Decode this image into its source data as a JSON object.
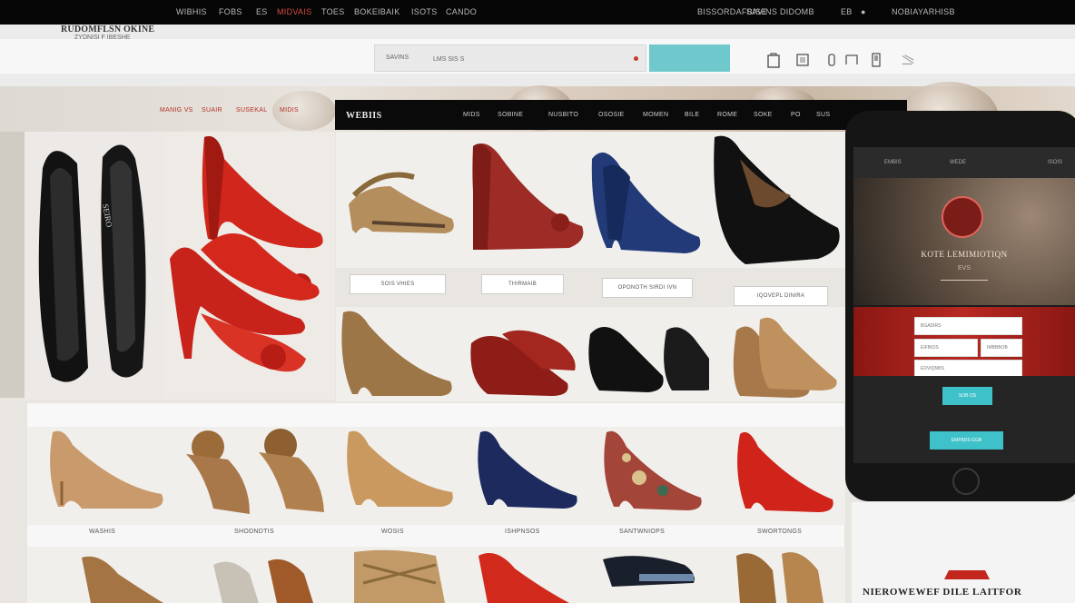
{
  "topbar": {
    "left_links": [
      "WIBHIS",
      "FOBS",
      "ES",
      "MIDVAIS",
      "TOES",
      "BOKE",
      "IBAIK",
      "ISOTS",
      "CANDO"
    ],
    "right_links": [
      "BISSORDAFBISE",
      "SAVINS DIDOMB",
      "EB",
      "●",
      "NOBIAYARHISB"
    ]
  },
  "header": {
    "logo": "RUDOMFLSN OKINE",
    "logo_sub": "ZYDNISI F IBESHE",
    "search_label": "SAVINS",
    "search_value": "LMS SIS S",
    "icons": [
      "bag-icon",
      "cart-icon",
      "user-icon",
      "star-icon",
      "lock-icon",
      "menu-icon"
    ]
  },
  "promo_links": [
    "MANIG VS",
    "SUAIR",
    "SUSEKAL",
    "MIDIS"
  ],
  "catnav": {
    "brand": "WEBIIS",
    "items": [
      "MIDS",
      "SOBINE",
      "NUSBITO",
      "OSOSIE",
      "MOMEN",
      "BILE",
      "ROME",
      "SOKE",
      "PO",
      "SUS"
    ]
  },
  "labels": {
    "row1": [
      "SOIS VHIES",
      "THIRMAIB",
      "OPONOTH SIRDI IVN",
      "IQOVEPL DINIRA"
    ],
    "row3": [
      "WASHIS",
      "SHODNDTIS",
      "WOSIS",
      "ISHPNSOS",
      "SANTWNIOPS",
      "SWORTONGS"
    ]
  },
  "phone": {
    "nav": [
      "EMBIS",
      "WEDE",
      "ISOIS"
    ],
    "title": "KOTE LEMIMIOTIQN",
    "sub": "EVS",
    "fields": [
      "BGADIRS",
      "EIFBIOS",
      "IMBBBOB",
      "EDVIQNBS"
    ],
    "btn1": "SOB OS",
    "btn2": "EMFBDS GGB"
  },
  "promo": {
    "title": "NIEROWEWEF DILE LAITFOR"
  },
  "colors": {
    "accent": "#6fc8cc",
    "brand_red": "#c2261d",
    "top_bar": "#060606"
  }
}
